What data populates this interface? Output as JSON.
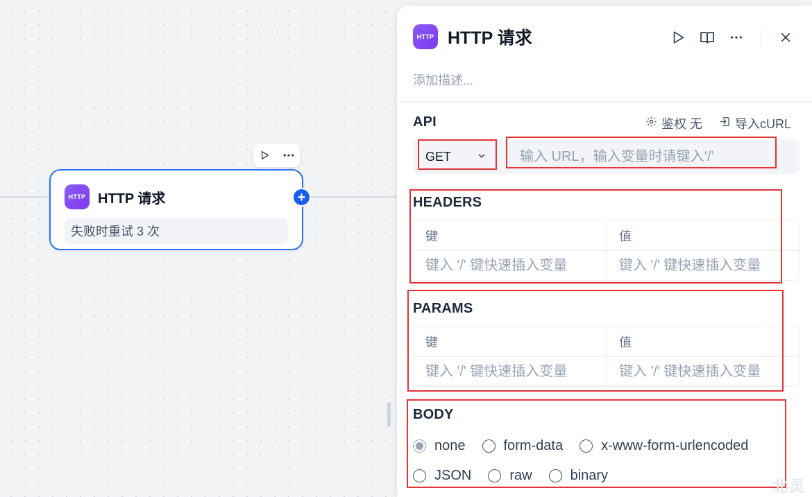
{
  "canvas": {
    "node": {
      "badge": "HTTP",
      "title": "HTTP 请求",
      "retry_text": "失败时重试 3 次",
      "add_symbol": "+"
    },
    "toolbar_icons": [
      "play-icon",
      "more-icon"
    ]
  },
  "panel": {
    "badge": "HTTP",
    "title": "HTTP 请求",
    "header_icons": [
      "play-icon",
      "book-icon",
      "more-icon",
      "close-icon"
    ],
    "description_placeholder": "添加描述...",
    "api": {
      "label": "API",
      "auth_label": "鉴权 无",
      "import_label": "导入cURL",
      "method": "GET",
      "url_value": "",
      "url_placeholder": "输入 URL，输入变量时请键入‘/’"
    },
    "headers": {
      "label": "HEADERS",
      "key_header": "键",
      "value_header": "值",
      "key_placeholder": "键入 '/' 键快速插入变量",
      "value_placeholder": "键入 '/' 键快速插入变量"
    },
    "params": {
      "label": "PARAMS",
      "key_header": "键",
      "value_header": "值",
      "key_placeholder": "键入 '/' 键快速插入变量",
      "value_placeholder": "键入 '/' 键快速插入变量"
    },
    "body": {
      "label": "BODY",
      "options": [
        "none",
        "form-data",
        "x-www-form-urlencoded",
        "JSON",
        "raw",
        "binary"
      ],
      "selected": "none"
    }
  },
  "watermark": "北灵",
  "colors": {
    "accent": "#2970ff",
    "badge": "#7c3aed",
    "highlight": "#e5333a"
  }
}
